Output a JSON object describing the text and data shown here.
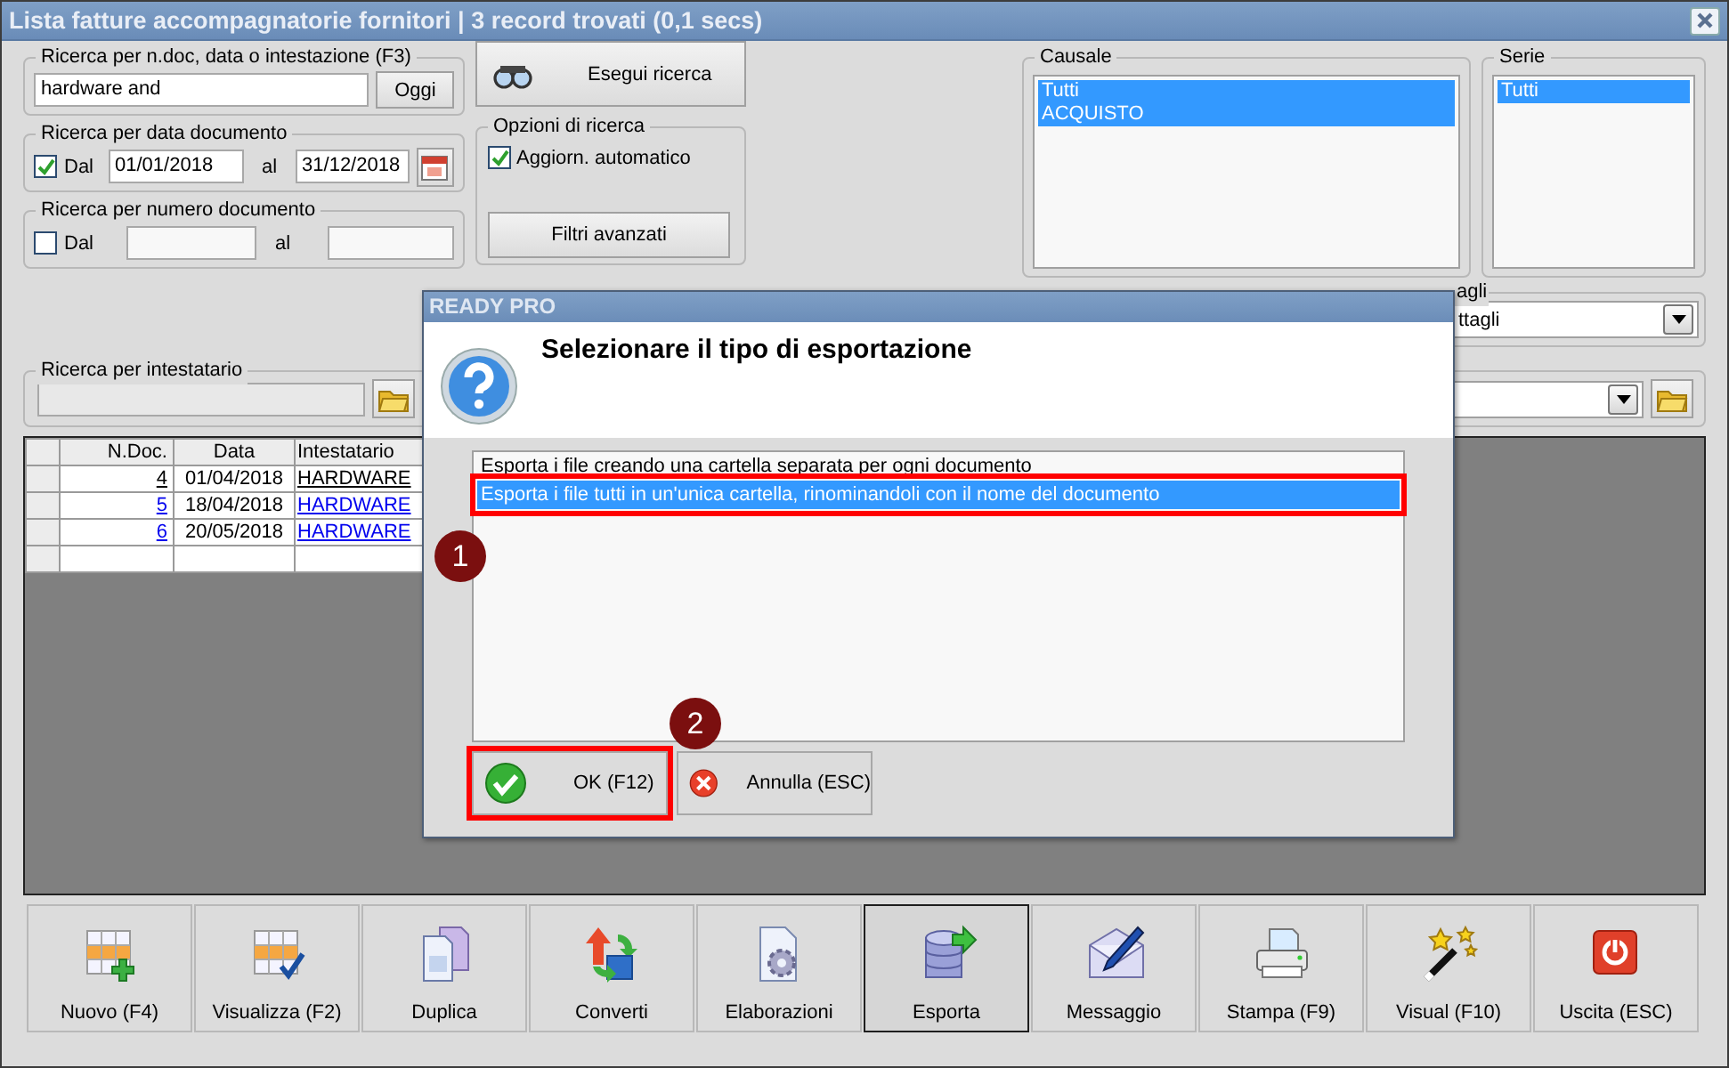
{
  "window": {
    "title": "Lista fatture accompagnatorie fornitori | 3 record trovati (0,1 secs)"
  },
  "search": {
    "label": "Ricerca per n.doc, data o intestazione (F3)",
    "value": "hardware and",
    "today_button": "Oggi"
  },
  "run_search_button": "Esegui ricerca",
  "date_filter": {
    "label": "Ricerca per data documento",
    "checked": true,
    "from_label": "Dal",
    "from": "01/01/2018",
    "to_label": "al",
    "to": "31/12/2018"
  },
  "number_filter": {
    "label": "Ricerca per numero documento",
    "checked": false,
    "from_label": "Dal",
    "to_label": "al"
  },
  "options": {
    "label": "Opzioni di ricerca",
    "auto_update": {
      "label": "Aggiorn. automatico",
      "checked": true
    },
    "advanced_button": "Filtri avanzati"
  },
  "causale": {
    "label": "Causale",
    "items": [
      {
        "text": "Tutti",
        "selected": true
      },
      {
        "text": "ACQUISTO",
        "selected": true
      }
    ]
  },
  "serie": {
    "label": "Serie",
    "items": [
      {
        "text": "Tutti",
        "selected": true
      }
    ]
  },
  "details": {
    "label": "agli",
    "value": "ttagli"
  },
  "holder": {
    "label": "Ricerca per intestatario",
    "disabled": true
  },
  "table": {
    "columns": [
      "N.Doc.",
      "Data",
      "Intestatario"
    ],
    "rows": [
      {
        "number": "4",
        "date": "01/04/2018",
        "holder": "HARDWARE",
        "current": true
      },
      {
        "number": "5",
        "date": "18/04/2018",
        "holder": "HARDWARE",
        "current": false
      },
      {
        "number": "6",
        "date": "20/05/2018",
        "holder": "HARDWARE",
        "current": false
      }
    ]
  },
  "toolbar": [
    {
      "label": "Nuovo (F4)",
      "pressed": false
    },
    {
      "label": "Visualizza (F2)",
      "pressed": false
    },
    {
      "label": "Duplica",
      "pressed": false
    },
    {
      "label": "Converti",
      "pressed": false
    },
    {
      "label": "Elaborazioni",
      "pressed": false
    },
    {
      "label": "Esporta",
      "pressed": true
    },
    {
      "label": "Messaggio",
      "pressed": false
    },
    {
      "label": "Stampa (F9)",
      "pressed": false
    },
    {
      "label": "Visual (F10)",
      "pressed": false
    },
    {
      "label": "Uscita (ESC)",
      "pressed": false
    }
  ],
  "dialog": {
    "title": "READY PRO",
    "heading": "Selezionare il tipo di esportazione",
    "options": [
      {
        "text": "Esporta i file creando una cartella separata per ogni documento",
        "selected": false,
        "highlighted": false
      },
      {
        "text": "Esporta i file tutti in un'unica cartella, rinominandoli con il nome del documento",
        "selected": true,
        "highlighted": true,
        "badge": "1"
      }
    ],
    "buttons": [
      {
        "label": "OK (F12)",
        "kind": "ok",
        "highlighted": true,
        "badge": "2"
      },
      {
        "label": "Annulla (ESC)",
        "kind": "cancel",
        "highlighted": false
      }
    ]
  }
}
